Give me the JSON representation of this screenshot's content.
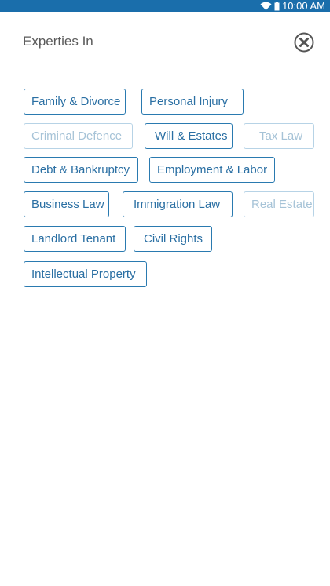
{
  "status_bar": {
    "time": "10:00 AM",
    "icons": [
      "wifi-icon",
      "battery-icon"
    ]
  },
  "header": {
    "title": "Experties In",
    "close_icon": "close-icon"
  },
  "chips": [
    {
      "label": "Family & Divorce",
      "enabled": true
    },
    {
      "label": "Personal Injury",
      "enabled": true
    },
    {
      "label": "Criminal Defence",
      "enabled": false
    },
    {
      "label": "Will & Estates",
      "enabled": true
    },
    {
      "label": "Tax Law",
      "enabled": false
    },
    {
      "label": "Debt & Bankruptcy",
      "enabled": true
    },
    {
      "label": "Employment & Labor",
      "enabled": true
    },
    {
      "label": "Business Law",
      "enabled": true
    },
    {
      "label": "Immigration Law",
      "enabled": true
    },
    {
      "label": "Real Estate",
      "enabled": false
    },
    {
      "label": "Landlord Tenant",
      "enabled": true
    },
    {
      "label": "Civil Rights",
      "enabled": true
    },
    {
      "label": "Intellectual Property",
      "enabled": true
    }
  ],
  "colors": {
    "status_bar": "#1a6eab",
    "chip_active": "#2a7ab0",
    "chip_disabled": "#b7d3e6"
  }
}
